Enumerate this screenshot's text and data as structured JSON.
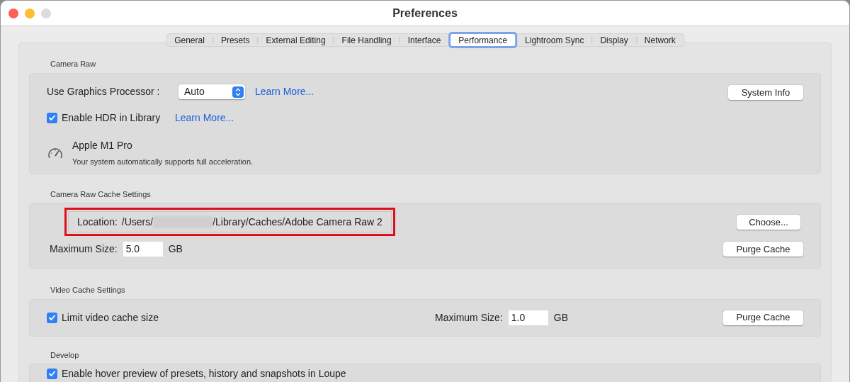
{
  "window": {
    "title": "Preferences"
  },
  "tabs": [
    {
      "label": "General",
      "selected": false
    },
    {
      "label": "Presets",
      "selected": false
    },
    {
      "label": "External Editing",
      "selected": false
    },
    {
      "label": "File Handling",
      "selected": false
    },
    {
      "label": "Interface",
      "selected": false
    },
    {
      "label": "Performance",
      "selected": true
    },
    {
      "label": "Lightroom Sync",
      "selected": false
    },
    {
      "label": "Display",
      "selected": false
    },
    {
      "label": "Network",
      "selected": false
    }
  ],
  "camera_raw": {
    "heading": "Camera Raw",
    "gpu_label": "Use Graphics Processor :",
    "gpu_value": "Auto",
    "gpu_link": "Learn More...",
    "system_info_button": "System Info",
    "hdr": {
      "label": "Enable HDR in Library",
      "checked": true
    },
    "hdr_link": "Learn More...",
    "gpu_name": "Apple M1 Pro",
    "gpu_note": "Your system automatically supports full acceleration."
  },
  "cache": {
    "heading": "Camera Raw Cache Settings",
    "location_label": "Location:",
    "path_start": "/Users/",
    "path_end": "/Library/Caches/Adobe Camera Raw 2",
    "choose_button": "Choose...",
    "max_label": "Maximum Size:",
    "max_value": "5.0",
    "unit": "GB",
    "purge_button": "Purge Cache"
  },
  "video": {
    "heading": "Video Cache Settings",
    "limit": {
      "label": "Limit video cache size",
      "checked": true
    },
    "max_label": "Maximum Size:",
    "max_value": "1.0",
    "unit": "GB",
    "purge_button": "Purge Cache"
  },
  "develop": {
    "heading": "Develop",
    "hover": {
      "label": "Enable hover preview of presets, history and snapshots in Loupe",
      "checked": true
    }
  }
}
